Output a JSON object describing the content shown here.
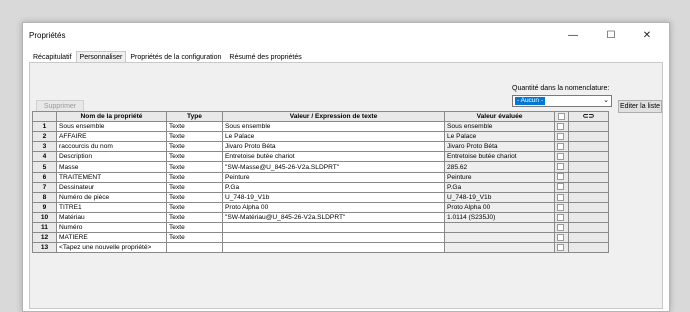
{
  "window": {
    "title": "Propriétés"
  },
  "window_buttons": {
    "minimize": "—",
    "maximize": "☐",
    "close": "✕"
  },
  "tabs": [
    {
      "label": "Récapitulatif",
      "active": false
    },
    {
      "label": "Personnaliser",
      "active": true
    },
    {
      "label": "Propriétés de la configuration",
      "active": false
    },
    {
      "label": "Résumé des propriétés",
      "active": false
    }
  ],
  "toolbar": {
    "delete_label": "Supprimer",
    "quantity_label": "Quantité dans la nomenclature:",
    "quantity_value": "- Aucun -",
    "edit_list_label": "Editer la liste"
  },
  "table": {
    "headers": [
      "",
      "Nom de la propriété",
      "Type",
      "Valeur / Expression de texte",
      "Valeur évaluée",
      "",
      "link-icon"
    ],
    "rows": [
      {
        "num": "1",
        "name": "Sous ensemble",
        "type": "Texte",
        "value": "Sous ensemble",
        "evaluated": "Sous ensemble"
      },
      {
        "num": "2",
        "name": "AFFAIRE",
        "type": "Texte",
        "value": "Le Palace",
        "evaluated": "Le Palace"
      },
      {
        "num": "3",
        "name": "raccourcis du nom",
        "type": "Texte",
        "value": "Jivaro Proto Béta",
        "evaluated": "Jivaro Proto Béta"
      },
      {
        "num": "4",
        "name": "Description",
        "type": "Texte",
        "value": "Entretoise butée chariot",
        "evaluated": "Entretoise butée chariot"
      },
      {
        "num": "5",
        "name": "Masse",
        "type": "Texte",
        "value": "\"SW-Masse@U_845-26-V2a.SLDPRT\"",
        "evaluated": "285.62"
      },
      {
        "num": "6",
        "name": "TRAITEMENT",
        "type": "Texte",
        "value": "Peinture",
        "evaluated": "Peinture"
      },
      {
        "num": "7",
        "name": "Dessinateur",
        "type": "Texte",
        "value": "P.Ga",
        "evaluated": "P.Ga"
      },
      {
        "num": "8",
        "name": "Numéro de pièce",
        "type": "Texte",
        "value": "U_748-19_V1b",
        "evaluated": "U_748-19_V1b"
      },
      {
        "num": "9",
        "name": "TITRE1",
        "type": "Texte",
        "value": "Proto Alpha 00",
        "evaluated": "Proto Alpha 00"
      },
      {
        "num": "10",
        "name": "Matériau",
        "type": "Texte",
        "value": "\"SW-Matériau@U_845-26-V2a.SLDPRT\"",
        "evaluated": "1.0114 (S235J0)"
      },
      {
        "num": "11",
        "name": "Numéro",
        "type": "Texte",
        "value": "",
        "evaluated": ""
      },
      {
        "num": "12",
        "name": "MATIERE",
        "type": "Texte",
        "value": "",
        "evaluated": ""
      },
      {
        "num": "13",
        "name": "<Tapez une nouvelle propriété>",
        "type": "",
        "value": "",
        "evaluated": ""
      }
    ]
  }
}
